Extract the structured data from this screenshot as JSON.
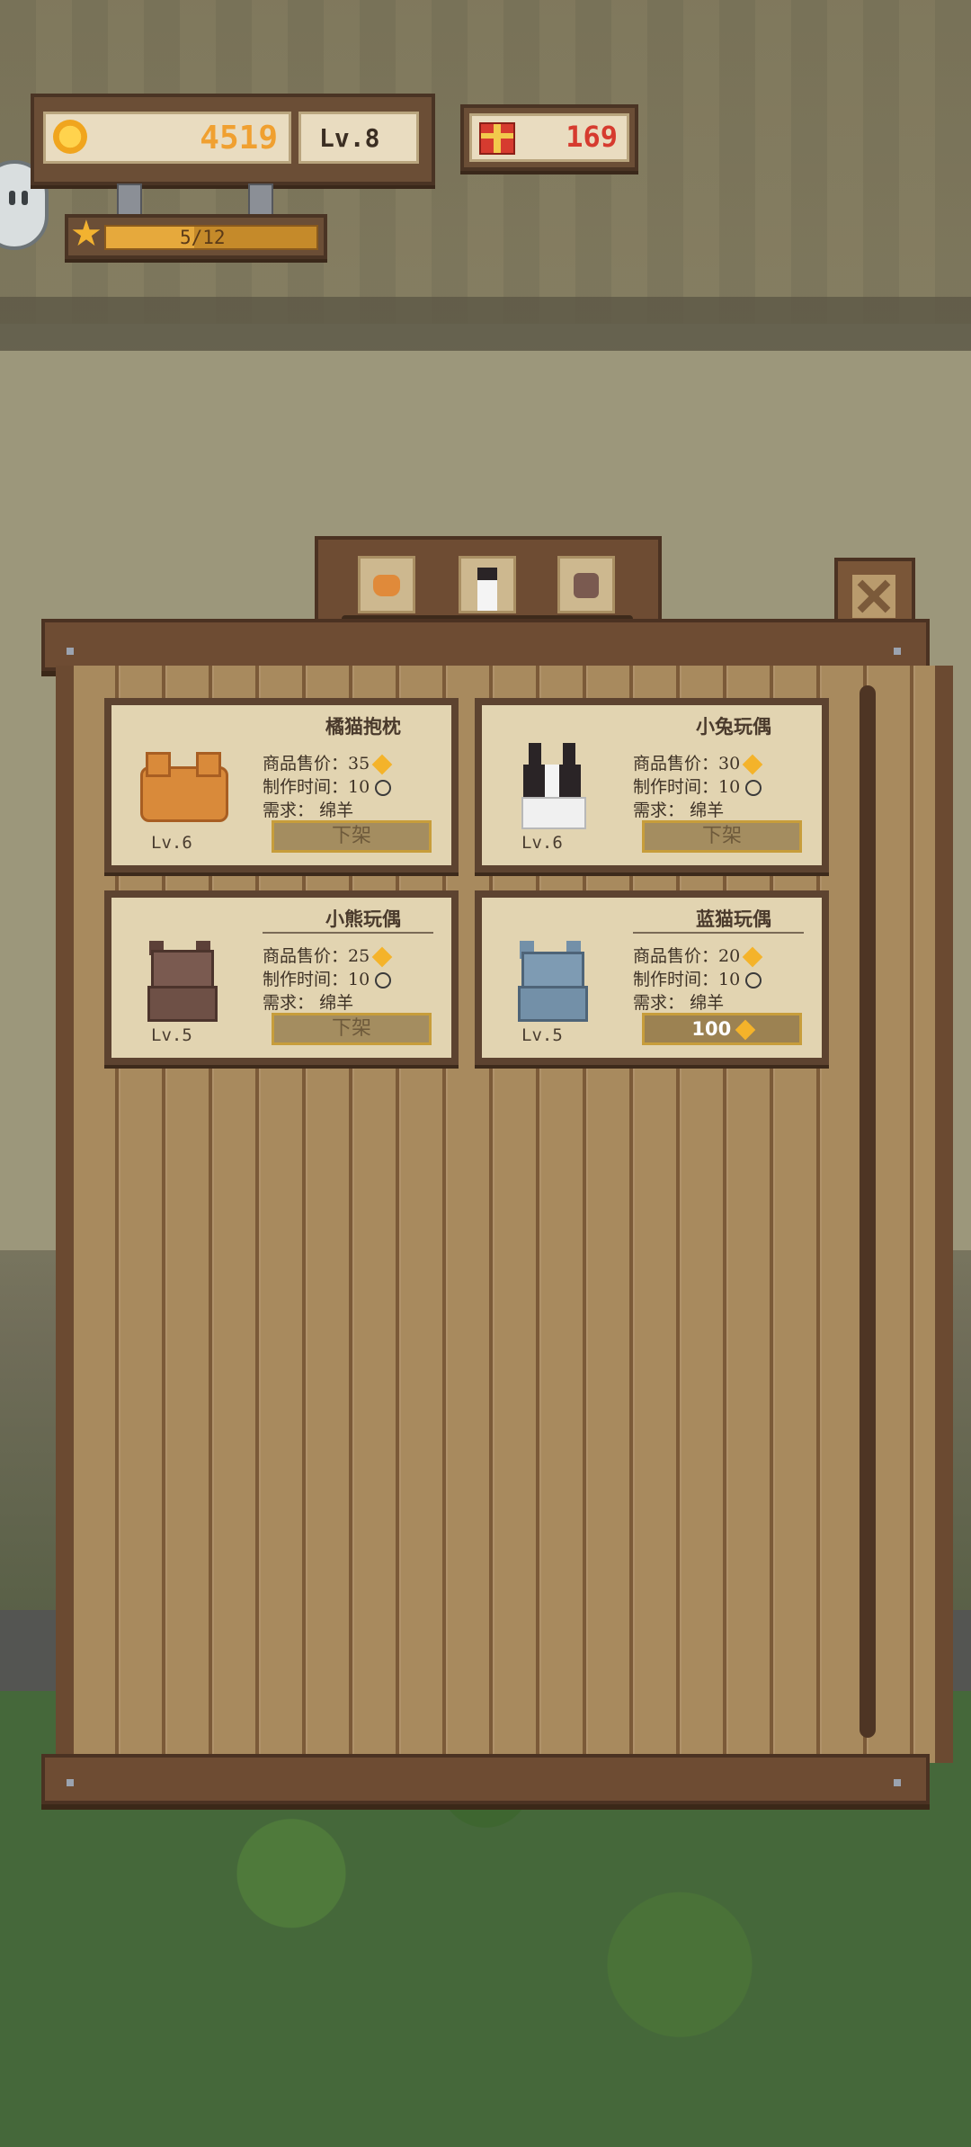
{
  "hud": {
    "coins": "4519",
    "level": "Lv.8",
    "gifts": "169",
    "star_progress": "5/12",
    "star_progress_fraction": 0.42
  },
  "tabs": [
    "orange-cat-icon",
    "rabbit-icon",
    "bear-icon"
  ],
  "items": [
    {
      "name": "橘猫抱枕",
      "price_label": "商品售价：",
      "price": "35",
      "time_label": "制作时间：",
      "time": "10",
      "need_label": "需求：",
      "need": "绵羊",
      "level": "Lv.6",
      "button": "下架",
      "sprite": "orange-cat-pillow-icon"
    },
    {
      "name": "小兔玩偶",
      "price_label": "商品售价：",
      "price": "30",
      "time_label": "制作时间：",
      "time": "10",
      "need_label": "需求：",
      "need": "绵羊",
      "level": "Lv.6",
      "button": "下架",
      "sprite": "bunny-doll-icon"
    },
    {
      "name": "小熊玩偶",
      "price_label": "商品售价：",
      "price": "25",
      "time_label": "制作时间：",
      "time": "10",
      "need_label": "需求：",
      "need": "绵羊",
      "level": "Lv.5",
      "button": "下架",
      "sprite": "bear-doll-icon"
    },
    {
      "name": "蓝猫玩偶",
      "price_label": "商品售价：",
      "price": "20",
      "time_label": "制作时间：",
      "time": "10",
      "need_label": "需求：",
      "need": "绵羊",
      "level": "Lv.5",
      "button": "100",
      "sprite": "blue-cat-doll-icon"
    }
  ],
  "colors": {
    "coin": "#f4b32a",
    "gift": "#d63b2f",
    "board": "#a88a5e",
    "frame": "#6e4c33"
  }
}
